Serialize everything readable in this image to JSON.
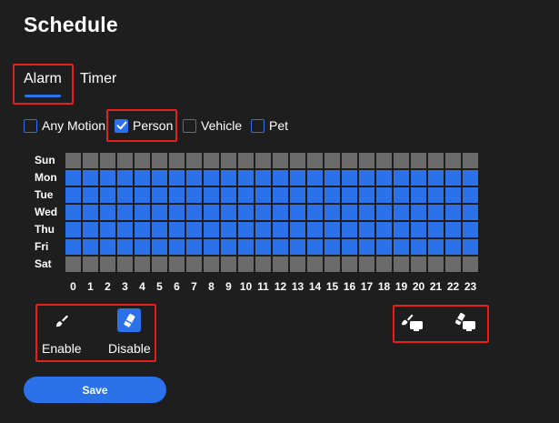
{
  "page": {
    "title": "Schedule"
  },
  "tabs": [
    {
      "label": "Alarm",
      "active": true
    },
    {
      "label": "Timer",
      "active": false
    }
  ],
  "filters": [
    {
      "label": "Any Motion",
      "checked": false
    },
    {
      "label": "Person",
      "checked": true
    },
    {
      "label": "Vehicle",
      "checked": false
    },
    {
      "label": "Pet",
      "checked": false
    }
  ],
  "schedule": {
    "days": [
      "Sun",
      "Mon",
      "Tue",
      "Wed",
      "Thu",
      "Fri",
      "Sat"
    ],
    "hours": [
      "0",
      "1",
      "2",
      "3",
      "4",
      "5",
      "6",
      "7",
      "8",
      "9",
      "10",
      "11",
      "12",
      "13",
      "14",
      "15",
      "16",
      "17",
      "18",
      "19",
      "20",
      "21",
      "22",
      "23"
    ],
    "enabled_days": [
      false,
      true,
      true,
      true,
      true,
      true,
      false
    ],
    "colors": {
      "enabled": "#2b72ea",
      "disabled": "#6b6b6b"
    }
  },
  "tools": {
    "enable_label": "Enable",
    "disable_label": "Disable",
    "enable_icon": "brush-icon",
    "disable_icon": "eraser-icon",
    "selected": "disable",
    "enable_all_icon": "brush-all-icon",
    "disable_all_icon": "eraser-all-icon"
  },
  "actions": {
    "save_label": "Save"
  },
  "colors": {
    "accent": "#2b72ea",
    "background": "#1e1e1e",
    "highlight": "#e3201b"
  }
}
